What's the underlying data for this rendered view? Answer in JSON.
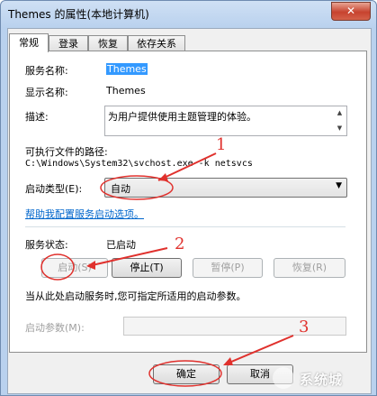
{
  "window": {
    "title": "Themes 的属性(本地计算机)",
    "close_glyph": "✕"
  },
  "tabs": [
    {
      "label": "常规"
    },
    {
      "label": "登录"
    },
    {
      "label": "恢复"
    },
    {
      "label": "依存关系"
    }
  ],
  "general": {
    "service_name_label": "服务名称:",
    "service_name_value": "Themes",
    "display_name_label": "显示名称:",
    "display_name_value": "Themes",
    "description_label": "描述:",
    "description_value": "为用户提供使用主题管理的体验。",
    "exe_path_label": "可执行文件的路径:",
    "exe_path_value": "C:\\Windows\\System32\\svchost.exe -k netsvcs",
    "startup_type_label": "启动类型(E):",
    "startup_type_value": "自动",
    "help_link": "帮助我配置服务启动选项。",
    "service_status_label": "服务状态:",
    "service_status_value": "已启动",
    "start_button": "启动(S)",
    "stop_button": "停止(T)",
    "pause_button": "暂停(P)",
    "resume_button": "恢复(R)",
    "start_params_hint": "当从此处启动服务时,您可指定所适用的启动参数。",
    "start_params_label": "启动参数(M):",
    "start_params_value": ""
  },
  "footer": {
    "ok_button": "确定",
    "cancel_button": "取消"
  },
  "annotations": {
    "num1": "1",
    "num2": "2",
    "num3": "3",
    "color": "#e0312d"
  },
  "watermark": {
    "text": "系统城"
  }
}
